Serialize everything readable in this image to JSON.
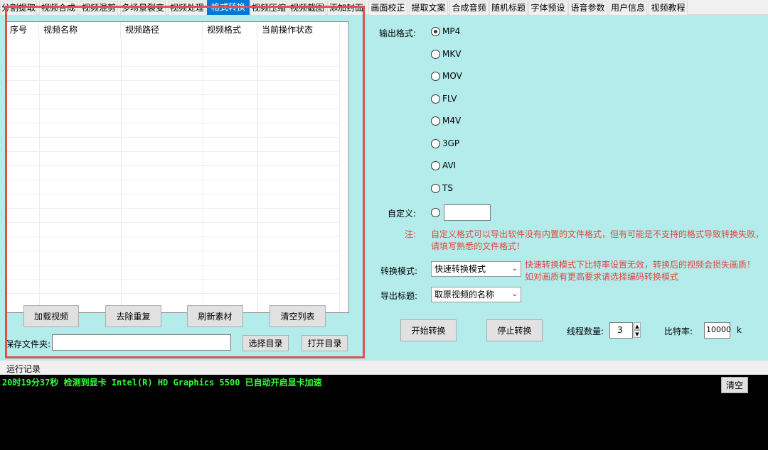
{
  "tabs": [
    {
      "label": "分割提取"
    },
    {
      "label": "视频合成"
    },
    {
      "label": "视频混剪"
    },
    {
      "label": "多场景裂变"
    },
    {
      "label": "视频处理"
    },
    {
      "label": "格式转换",
      "active": true
    },
    {
      "label": "视频压缩"
    },
    {
      "label": "视频截图"
    },
    {
      "label": "添加封面"
    },
    {
      "label": "画面校正"
    },
    {
      "label": "提取文案"
    },
    {
      "label": "合成音频"
    },
    {
      "label": "随机标题"
    },
    {
      "label": "字体预设"
    },
    {
      "label": "语音参数"
    },
    {
      "label": "用户信息"
    },
    {
      "label": "视频教程"
    }
  ],
  "grid": {
    "columns": [
      "序号",
      "视频名称",
      "视频路径",
      "视频格式",
      "当前操作状态"
    ],
    "rows": []
  },
  "left_buttons": {
    "load": "加载视频",
    "dedupe": "去除重复",
    "refresh": "刷新素材",
    "clear_list": "清空列表"
  },
  "save_folder": {
    "label": "保存文件夹:",
    "value": "",
    "select_dir": "选择目录",
    "open_dir": "打开目录"
  },
  "output_format": {
    "label": "输出格式:",
    "options": [
      "MP4",
      "MKV",
      "MOV",
      "FLV",
      "M4V",
      "3GP",
      "AVI",
      "TS"
    ],
    "selected": "MP4",
    "custom_label": "自定义:",
    "custom_value": ""
  },
  "note": {
    "label": "注:",
    "line1": "自定义格式可以导出软件没有内置的文件格式，但有可能是不支持的格式导致转换失败，",
    "line2": "请填写熟悉的文件格式！"
  },
  "convert_mode": {
    "label": "转换模式:",
    "value": "快速转换模式",
    "hint1": "快速转换模式下比特率设置无效，转换后的视频会损失画质！",
    "hint2": "如对画质有更高要求请选择编码转换模式"
  },
  "export_title": {
    "label": "导出标题:",
    "value": "取原视频的名称"
  },
  "actions": {
    "start": "开始转换",
    "stop": "停止转换",
    "threads_label": "线程数量:",
    "threads_value": "3",
    "bitrate_label": "比特率:",
    "bitrate_value": "10000",
    "bitrate_unit": "k"
  },
  "log": {
    "label": "运行记录",
    "clear": "清空",
    "lines": [
      "20时19分37秒 检测到显卡 Intel(R) HD Graphics 5500 已自动开启显卡加速"
    ]
  },
  "colors": {
    "panel_bg": "#b4ecec",
    "active_tab": "#0078d7",
    "note_red": "#e0453c",
    "log_green": "#33ff33",
    "highlight_red": "#e05050"
  }
}
